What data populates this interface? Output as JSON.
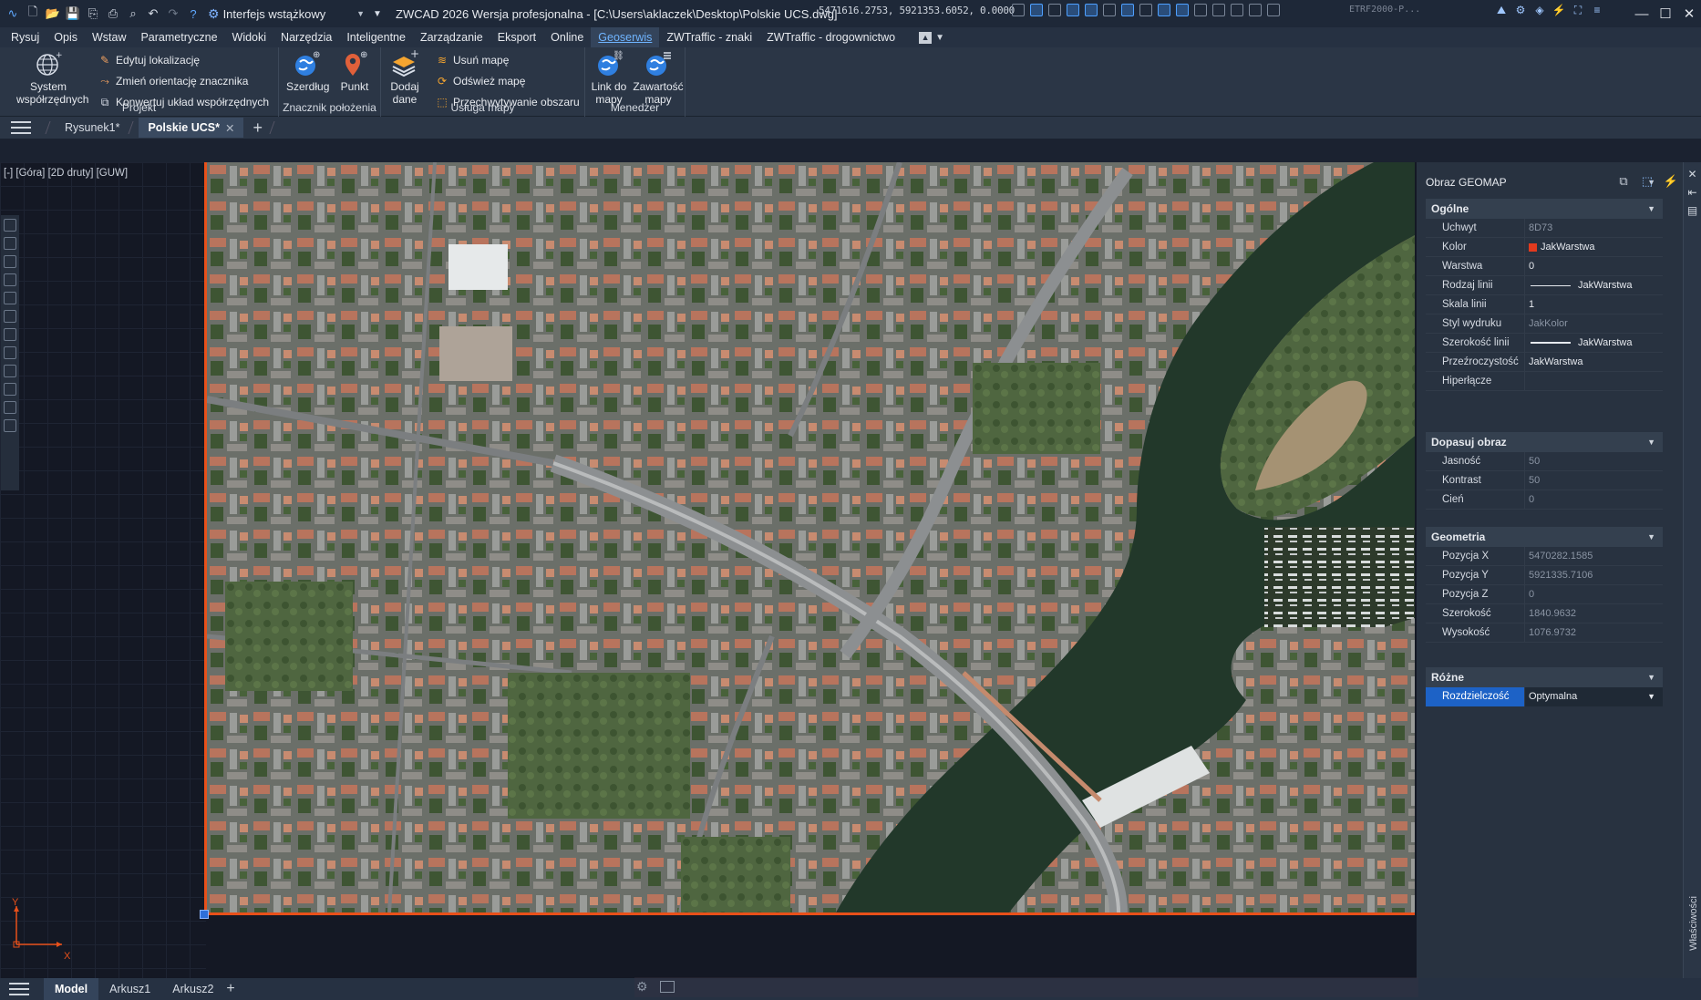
{
  "app": {
    "workspace": "Interfejs wstążkowy",
    "title": "ZWCAD 2026 Wersja profesjonalna - [C:\\Users\\aklaczek\\Desktop\\Polskie UCS.dwg]"
  },
  "menu": [
    "Rysuj",
    "Opis",
    "Wstaw",
    "Parametryczne",
    "Widoki",
    "Narzędzia",
    "Inteligentne",
    "Zarządzanie",
    "Eksport",
    "Online",
    "Geoserwis",
    "ZWTraffic - znaki",
    "ZWTraffic - drogownictwo"
  ],
  "ribbon": {
    "projekt": {
      "label": "Projekt",
      "big": "System współrzędnych",
      "small": [
        "Edytuj lokalizację",
        "Zmień orientację znacznika",
        "Konwertuj układ współrzędnych"
      ]
    },
    "znacznik": {
      "label": "Znacznik położenia",
      "buttons": [
        "Szerdług",
        "Punkt"
      ]
    },
    "usluga": {
      "label": "Usługa mapy",
      "big": "Dodaj dane",
      "small": [
        "Usuń mapę",
        "Odśwież mapę",
        "Przechwytywanie obszaru"
      ]
    },
    "menedzer": {
      "label": "Menedżer",
      "buttons": [
        "Link do mapy",
        "Zawartość mapy"
      ]
    }
  },
  "tabs": [
    {
      "label": "Rysunek1*",
      "active": false
    },
    {
      "label": "Polskie UCS*",
      "active": true
    }
  ],
  "viewport": {
    "label": "[-] [Góra] [2D druty] [GUW]",
    "ucs_x": "X",
    "ucs_y": "Y"
  },
  "properties": {
    "object_type": "Obraz GEOMAP",
    "sections": {
      "ogolne": {
        "title": "Ogólne",
        "rows": [
          {
            "name": "Uchwyt",
            "value": "8D73"
          },
          {
            "name": "Kolor",
            "value": "JakWarstwa"
          },
          {
            "name": "Warstwa",
            "value": "0"
          },
          {
            "name": "Rodzaj linii",
            "value": "JakWarstwa"
          },
          {
            "name": "Skala linii",
            "value": "1"
          },
          {
            "name": "Styl wydruku",
            "value": "JakKolor"
          },
          {
            "name": "Szerokość linii",
            "value": "JakWarstwa"
          },
          {
            "name": "Przeźroczystość",
            "value": "JakWarstwa"
          },
          {
            "name": "Hiperłącze",
            "value": ""
          }
        ]
      },
      "dopasuj": {
        "title": "Dopasuj obraz",
        "rows": [
          {
            "name": "Jasność",
            "value": "50"
          },
          {
            "name": "Kontrast",
            "value": "50"
          },
          {
            "name": "Cień",
            "value": "0"
          }
        ]
      },
      "geometria": {
        "title": "Geometria",
        "rows": [
          {
            "name": "Pozycja X",
            "value": "5470282.1585"
          },
          {
            "name": "Pozycja Y",
            "value": "5921335.7106"
          },
          {
            "name": "Pozycja Z",
            "value": "0"
          },
          {
            "name": "Szerokość",
            "value": "1840.9632"
          },
          {
            "name": "Wysokość",
            "value": "1076.9732"
          }
        ]
      },
      "rozne": {
        "title": "Różne",
        "rows": [
          {
            "name": "Rozdzielczość",
            "value": "Optymalna"
          }
        ]
      }
    },
    "side_label": "Właściwości"
  },
  "status": {
    "layouts": [
      "Model",
      "Arkusz1",
      "Arkusz2"
    ],
    "coords": "5471616.2753, 5921353.6052, 0.0000",
    "crs": "ETRF2000-P..."
  },
  "colors": {
    "accent": "#e8501a",
    "selection": "#1d62c6",
    "active_menu": "#6fb4ff"
  }
}
